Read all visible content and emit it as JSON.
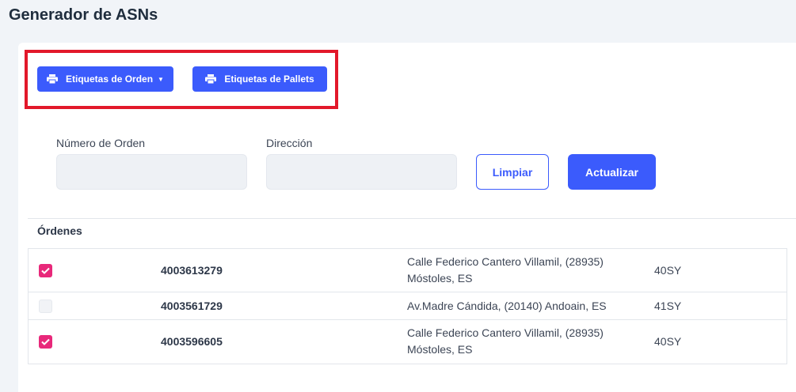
{
  "page": {
    "title": "Generador de ASNs"
  },
  "toolbar": {
    "orden_label": "Etiquetas de Orden",
    "pallets_label": "Etiquetas de Pallets"
  },
  "filters": {
    "order_label": "Número de Orden",
    "order_value": "",
    "address_label": "Dirección",
    "address_value": "",
    "clear_label": "Limpiar",
    "update_label": "Actualizar"
  },
  "orders": {
    "title": "Órdenes",
    "rows": [
      {
        "checked": true,
        "number": "4003613279",
        "address_line1": "Calle Federico Cantero Villamil, (28935)",
        "address_line2": "Móstoles, ES",
        "code": "40SY"
      },
      {
        "checked": false,
        "number": "4003561729",
        "address_line1": "Av.Madre Cándida, (20140) Andoain, ES",
        "address_line2": "",
        "code": "41SY"
      },
      {
        "checked": true,
        "number": "4003596605",
        "address_line1": "Calle Federico Cantero Villamil, (28935)",
        "address_line2": "Móstoles, ES",
        "code": "40SY"
      }
    ]
  },
  "colors": {
    "primary": "#3b5bfc",
    "checkbox_checked": "#e8287a",
    "highlight": "#e2182a"
  },
  "icons": {
    "print": "printer-icon",
    "caret": "chevron-down-icon",
    "check": "check-icon"
  }
}
